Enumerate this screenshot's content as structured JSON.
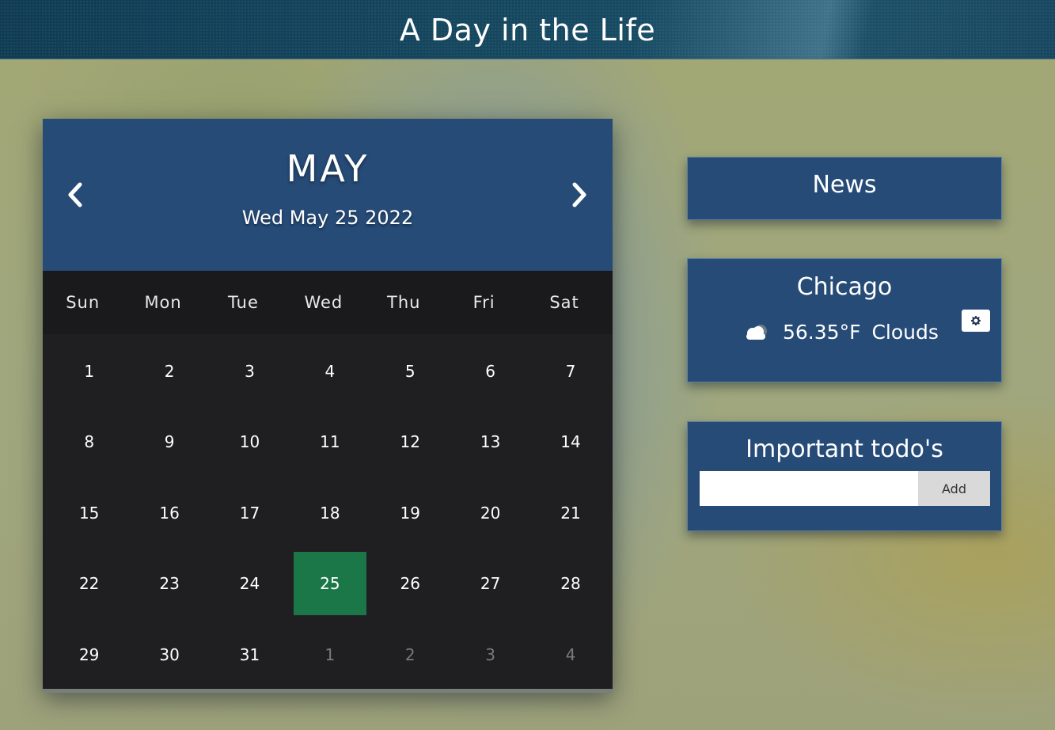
{
  "header": {
    "title": "A Day in the Life"
  },
  "calendar": {
    "month": "MAY",
    "date_line": "Wed May 25 2022",
    "prev_icon": "chevron-left-icon",
    "next_icon": "chevron-right-icon",
    "weekdays": [
      "Sun",
      "Mon",
      "Tue",
      "Wed",
      "Thu",
      "Fri",
      "Sat"
    ],
    "today": "25",
    "today_color": "#1b7648",
    "weeks": [
      [
        {
          "d": "1"
        },
        {
          "d": "2"
        },
        {
          "d": "3"
        },
        {
          "d": "4"
        },
        {
          "d": "5"
        },
        {
          "d": "6"
        },
        {
          "d": "7"
        }
      ],
      [
        {
          "d": "8"
        },
        {
          "d": "9"
        },
        {
          "d": "10"
        },
        {
          "d": "11"
        },
        {
          "d": "12"
        },
        {
          "d": "13"
        },
        {
          "d": "14"
        }
      ],
      [
        {
          "d": "15"
        },
        {
          "d": "16"
        },
        {
          "d": "17"
        },
        {
          "d": "18"
        },
        {
          "d": "19"
        },
        {
          "d": "20"
        },
        {
          "d": "21"
        }
      ],
      [
        {
          "d": "22"
        },
        {
          "d": "23"
        },
        {
          "d": "24"
        },
        {
          "d": "25",
          "today": true
        },
        {
          "d": "26"
        },
        {
          "d": "27"
        },
        {
          "d": "28"
        }
      ],
      [
        {
          "d": "29"
        },
        {
          "d": "30"
        },
        {
          "d": "31"
        },
        {
          "d": "1",
          "other": true
        },
        {
          "d": "2",
          "other": true
        },
        {
          "d": "3",
          "other": true
        },
        {
          "d": "4",
          "other": true
        }
      ]
    ]
  },
  "news": {
    "title": "News"
  },
  "weather": {
    "city": "Chicago",
    "icon": "cloud-icon",
    "temperature": "56.35°F",
    "condition": "Clouds",
    "settings_icon": "gear-icon"
  },
  "todo": {
    "title": "Important todo's",
    "input_value": "",
    "input_placeholder": "",
    "add_label": "Add"
  },
  "colors": {
    "panel_blue": "#264b77",
    "calendar_dark": "#1f1f22"
  }
}
